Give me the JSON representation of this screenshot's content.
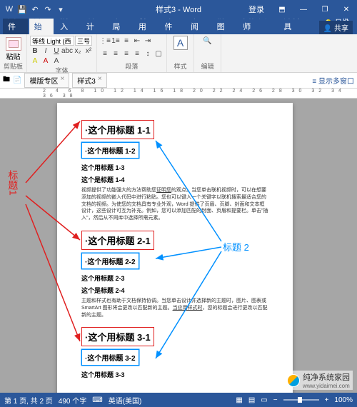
{
  "titlebar": {
    "title": "样式3 - Word",
    "login": "登录"
  },
  "qat": {
    "save": "💾",
    "undo": "↶",
    "redo": "↷",
    "dd": "▾"
  },
  "win": {
    "ribbonmin": "⬒",
    "min": "—",
    "restore": "❐",
    "close": "✕"
  },
  "tabs": {
    "file": "文件",
    "home": "开始",
    "insert": "插入",
    "design": "设计",
    "layout": "布局",
    "refs": "引用",
    "mail": "邮件",
    "review": "审阅",
    "view": "视图",
    "beautify": "美化大师",
    "dev": "开发工具"
  },
  "tellme": {
    "bulb": "💡",
    "text": "告诉我"
  },
  "share": {
    "icon": "👤",
    "text": "共享"
  },
  "ribbon": {
    "paste_label": "粘贴",
    "clipboard": "剪贴板",
    "font": "等线 Light (西文标题)",
    "size": "三号",
    "font_label": "字体",
    "para_label": "段落",
    "styles_label": "样式",
    "edit_label": "编辑",
    "styleA": "A"
  },
  "subbar": {
    "ico1": "🖿",
    "ico2": "📄",
    "tab1": "模版专区",
    "tab2": "样式3",
    "close": "×",
    "more": "≡ 显示多窗口"
  },
  "ruler": "2 4 6 8 10 12 14 16 18 20 22 24 26 28 30 32 34 36 38",
  "doc": {
    "h1_1": "·这个用标题 1-1",
    "h2_12": "·这个用标题 1-2",
    "h3_13": "这个用标题 1-3",
    "h3_14": "这个是标题 1-4",
    "p1a": "视频提供了功能强大的方法帮助您",
    "p1u": "证明您",
    "p1b": "的观点。当您单击联机视频时，可以在想要添加的视频的嵌入代码中进行粘贴。您也可以键入一个关键字以联机搜索最适合您的文档的视频。为使您的文档具有专业外观，Word 提供了页眉、页脚、封面和文本框设计，这些设计可互为补充。例如，您可以添加匹配的封面、页眉和提要栏。单击\"插入\"，然后从不同库中选择所需元素。",
    "h1_2": "·这个用标题 2-1",
    "h2_22": "·这个用标题 2-2",
    "h3_23": "这个用标题 2-3",
    "h3_24": "这个是标题 2-4",
    "p2a": "主题和样式也有助于文档保持协调。当您单击设计并选择新的主题时，图片、图表或 SmartArt 图形将会更改以匹配新的主题。",
    "p2u": "当应用样式时",
    "p2b": "，您的标题会进行更改以匹配新的主题。",
    "h1_3": "·这个用标题 3-1",
    "h2_32": "·这个用标题 3-2",
    "h3_33": "这个用标题 3-3"
  },
  "annot": {
    "left": "标题1",
    "right": "标题 2"
  },
  "status": {
    "page": "第 1 页, 共 2 页",
    "words": "490 个字",
    "lang": "英语(美国)",
    "ico_keyboard": "⌨",
    "view1": "▦",
    "view2": "▤",
    "view3": "▭",
    "zm_out": "−",
    "zm_in": "+",
    "zoom": "100%"
  },
  "watermark": {
    "text": "纯净系统家园",
    "url": "www.yidaimei.com"
  }
}
